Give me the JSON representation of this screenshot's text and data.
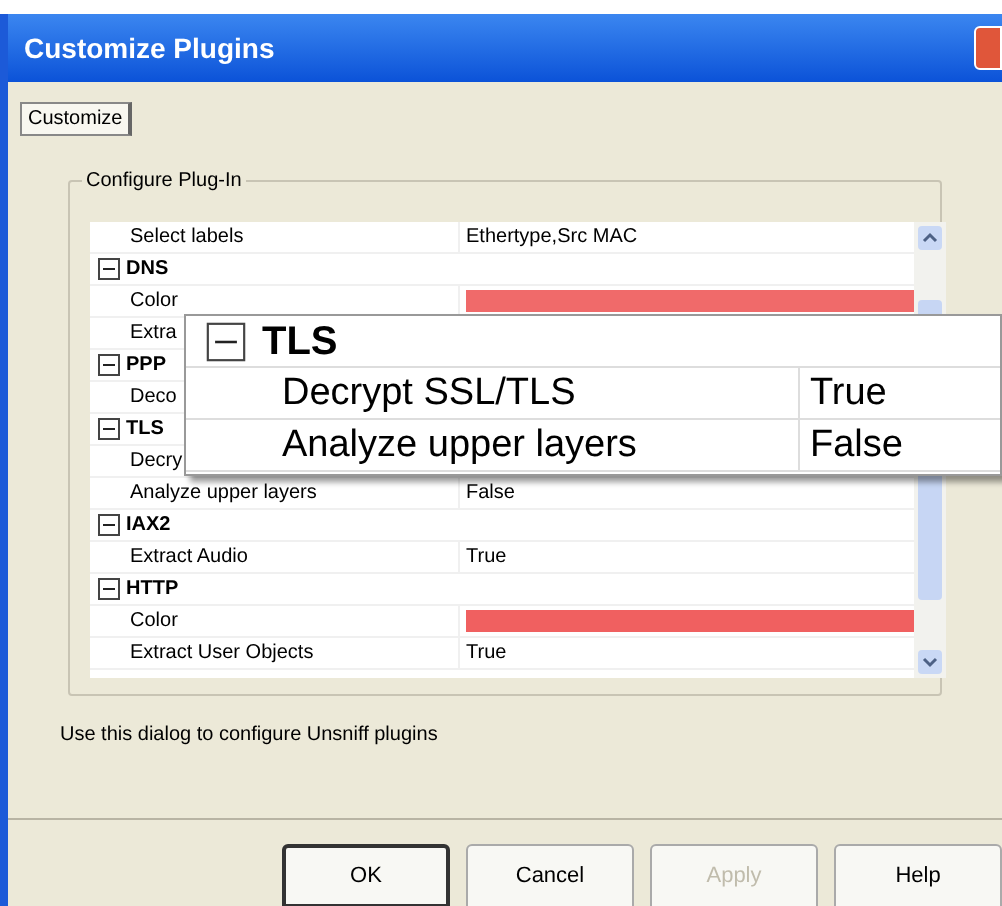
{
  "window": {
    "title": "Customize Plugins"
  },
  "tabs": [
    {
      "label": "Customize",
      "selected": true
    }
  ],
  "group_box": {
    "title": "Configure Plug-In"
  },
  "grid_rows": [
    {
      "kind": "property",
      "label": "Select labels",
      "value": "Ethertype,Src MAC"
    },
    {
      "kind": "group",
      "label": "DNS",
      "expanded": true
    },
    {
      "kind": "color",
      "label": "Color",
      "color": "#f06a6a"
    },
    {
      "kind": "property",
      "label": "Extra"
    },
    {
      "kind": "group",
      "label": "PPP",
      "expanded": true
    },
    {
      "kind": "property",
      "label": "Deco"
    },
    {
      "kind": "group",
      "label": "TLS",
      "expanded": true
    },
    {
      "kind": "property",
      "label": "Decry"
    },
    {
      "kind": "property",
      "label": "Analyze upper layers",
      "value": "False"
    },
    {
      "kind": "group",
      "label": "IAX2",
      "expanded": true
    },
    {
      "kind": "property",
      "label": "Extract Audio",
      "value": "True"
    },
    {
      "kind": "group",
      "label": "HTTP",
      "expanded": true
    },
    {
      "kind": "color",
      "label": "Color",
      "color": "#f06060"
    },
    {
      "kind": "property",
      "label": "Extract User Objects",
      "value": "True"
    }
  ],
  "callout": {
    "rows": [
      {
        "kind": "group",
        "label": "TLS",
        "expanded": true
      },
      {
        "kind": "property",
        "label": "Decrypt SSL/TLS",
        "value": "True"
      },
      {
        "kind": "property",
        "label": "Analyze upper layers",
        "value": "False"
      }
    ]
  },
  "description": "Use this dialog to configure Unsniff plugins",
  "buttons": [
    {
      "label": "OK",
      "disabled": false,
      "default": true
    },
    {
      "label": "Cancel",
      "disabled": false,
      "default": false
    },
    {
      "label": "Apply",
      "disabled": true,
      "default": false
    },
    {
      "label": "Help",
      "disabled": false,
      "default": false
    }
  ]
}
